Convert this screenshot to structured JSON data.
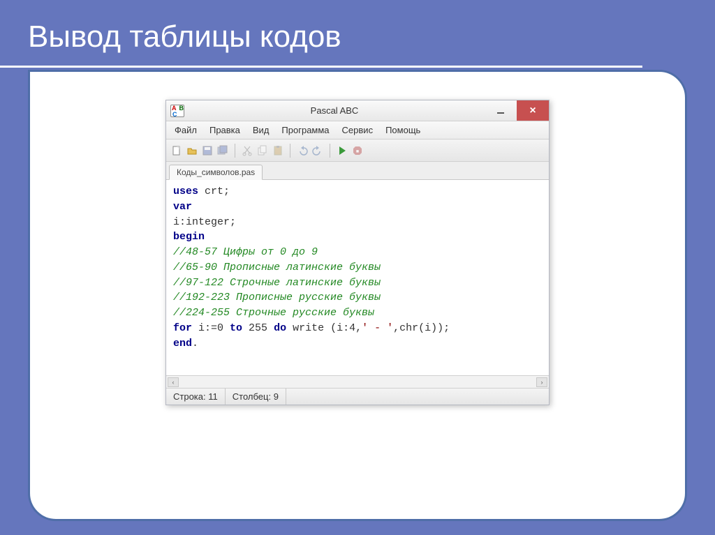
{
  "slide": {
    "title": "Вывод таблицы кодов"
  },
  "window": {
    "title": "Pascal ABC",
    "menu": [
      "Файл",
      "Правка",
      "Вид",
      "Программа",
      "Сервис",
      "Помощь"
    ],
    "tab": "Коды_символов.pas",
    "status": {
      "line_label": "Строка:",
      "line": "11",
      "col_label": "Столбец:",
      "col": "9"
    }
  },
  "code": {
    "l1_kw": "uses",
    "l1_rest": " crt;",
    "l2_kw": "var",
    "l3": "i:integer;",
    "l4_kw": "begin",
    "l5_cm": "//48-57 Цифры от 0 до 9",
    "l6_cm": "//65-90 Прописные латинские буквы",
    "l7_cm": "//97-122 Строчные латинские буквы",
    "l8_cm": "//192-223 Прописные русские буквы",
    "l9_cm": "//224-255 Строчные русские буквы",
    "l10_kw1": "for",
    "l10_a": " i:=0 ",
    "l10_kw2": "to",
    "l10_b": " 255 ",
    "l10_kw3": "do",
    "l10_c": " write (i:4,",
    "l10_str": "' - '",
    "l10_d": ",chr(i));",
    "l11_kw": "end",
    "l11_rest": "."
  }
}
